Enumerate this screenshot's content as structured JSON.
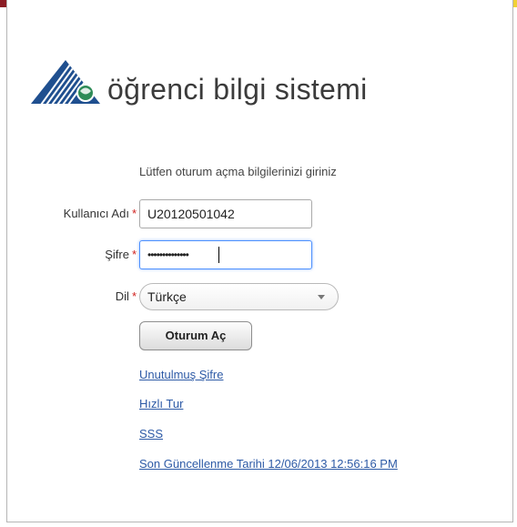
{
  "header": {
    "strip_colors": [
      "#8b1c24",
      "#c9302c",
      "#e2882e",
      "#e7b64a",
      "#8cc04b",
      "#7db8e0",
      "#3a66b4",
      "#f0d035"
    ],
    "logo_text": "öğrenci bilgi sistemi",
    "logo_icon": "mountain-globe-logo-icon"
  },
  "login": {
    "intro": "Lütfen oturum açma bilgilerinizi giriniz",
    "username_label": "Kullanıcı Adı",
    "username_value": "U20120501042",
    "password_label": "Şifre",
    "password_value": "••••••••••••••",
    "language_label": "Dil",
    "language_value": "Türkçe",
    "required_marker": "*",
    "submit_label": "Oturum Aç"
  },
  "links": {
    "forgot_password": "Unutulmuş Şifre",
    "quick_tour": "Hızlı Tur",
    "faq": "SSS",
    "last_updated": "Son Güncellenme Tarihi 12/06/2013 12:56:16 PM"
  }
}
